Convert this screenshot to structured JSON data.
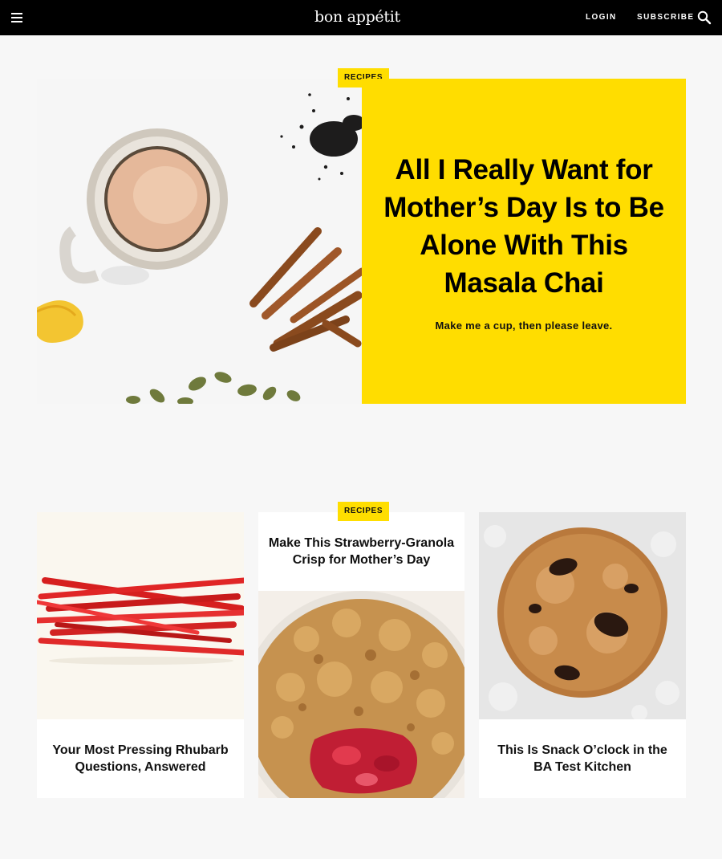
{
  "nav": {
    "logo_text": "bon appétit",
    "login_label": "LOGIN",
    "subscribe_label": "SUBSCRIBE",
    "menu_icon": "hamburger-menu-icon",
    "search_icon": "search-icon",
    "background_color": "#000000"
  },
  "hero": {
    "tag": "RECIPES",
    "title": "All I Really Want for Mother’s Day Is to Be Alone With This Masala Chai",
    "dek": "Make me a cup, then please leave.",
    "panel_color": "#ffdd00",
    "image_description_icon": "masala-chai-photo"
  },
  "cards": [
    {
      "title": "Your Most Pressing Rhubarb Questions, Answered",
      "image": "rhubarb-photo"
    },
    {
      "tag": "RECIPES",
      "title": "Make This Strawberry-Granola Crisp for Mother’s Day",
      "image": "strawberry-granola-crisp-photo"
    },
    {
      "title": "This Is Snack O’clock in the BA Test Kitchen",
      "image": "chocolate-chip-cookie-photo"
    }
  ],
  "colors": {
    "accent_yellow": "#ffde00",
    "page_background": "#f7f7f7"
  }
}
